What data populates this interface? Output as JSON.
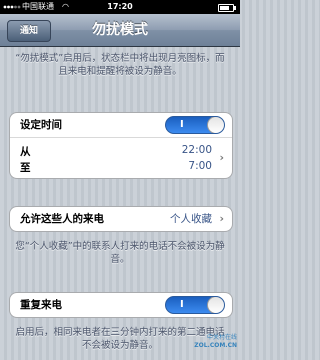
{
  "status_bar": {
    "carrier": "中国联通",
    "time": "17:20",
    "wifi_icon": "wifi-icon",
    "battery_icon": "battery-icon"
  },
  "nav": {
    "back_label": "通知",
    "title": "勿扰模式"
  },
  "intro_note": "“勿扰模式”启用后，状态栏中将出现月亮图标，而且来电和提醒将被设为静音。",
  "schedule": {
    "label": "设定时间",
    "toggle_on": "I",
    "from_label": "从",
    "from_value": "22:00",
    "to_label": "至",
    "to_value": "7:00"
  },
  "allow_calls": {
    "label": "允许这些人的来电",
    "value": "个人收藏",
    "note": "您“个人收藏”中的联系人打来的电话不会被设为静音。"
  },
  "repeat_calls": {
    "label": "重复来电",
    "toggle_on": "I",
    "note": "启用后，相同来电者在三分钟内打来的第二通电话不会被设为静音。"
  },
  "watermark": {
    "line1": "中关村在线",
    "line2": "ZOL.COM.CN"
  },
  "colors": {
    "accent_blue": "#3c8bf0",
    "value_text": "#385487",
    "background": "#c5ccd4"
  }
}
